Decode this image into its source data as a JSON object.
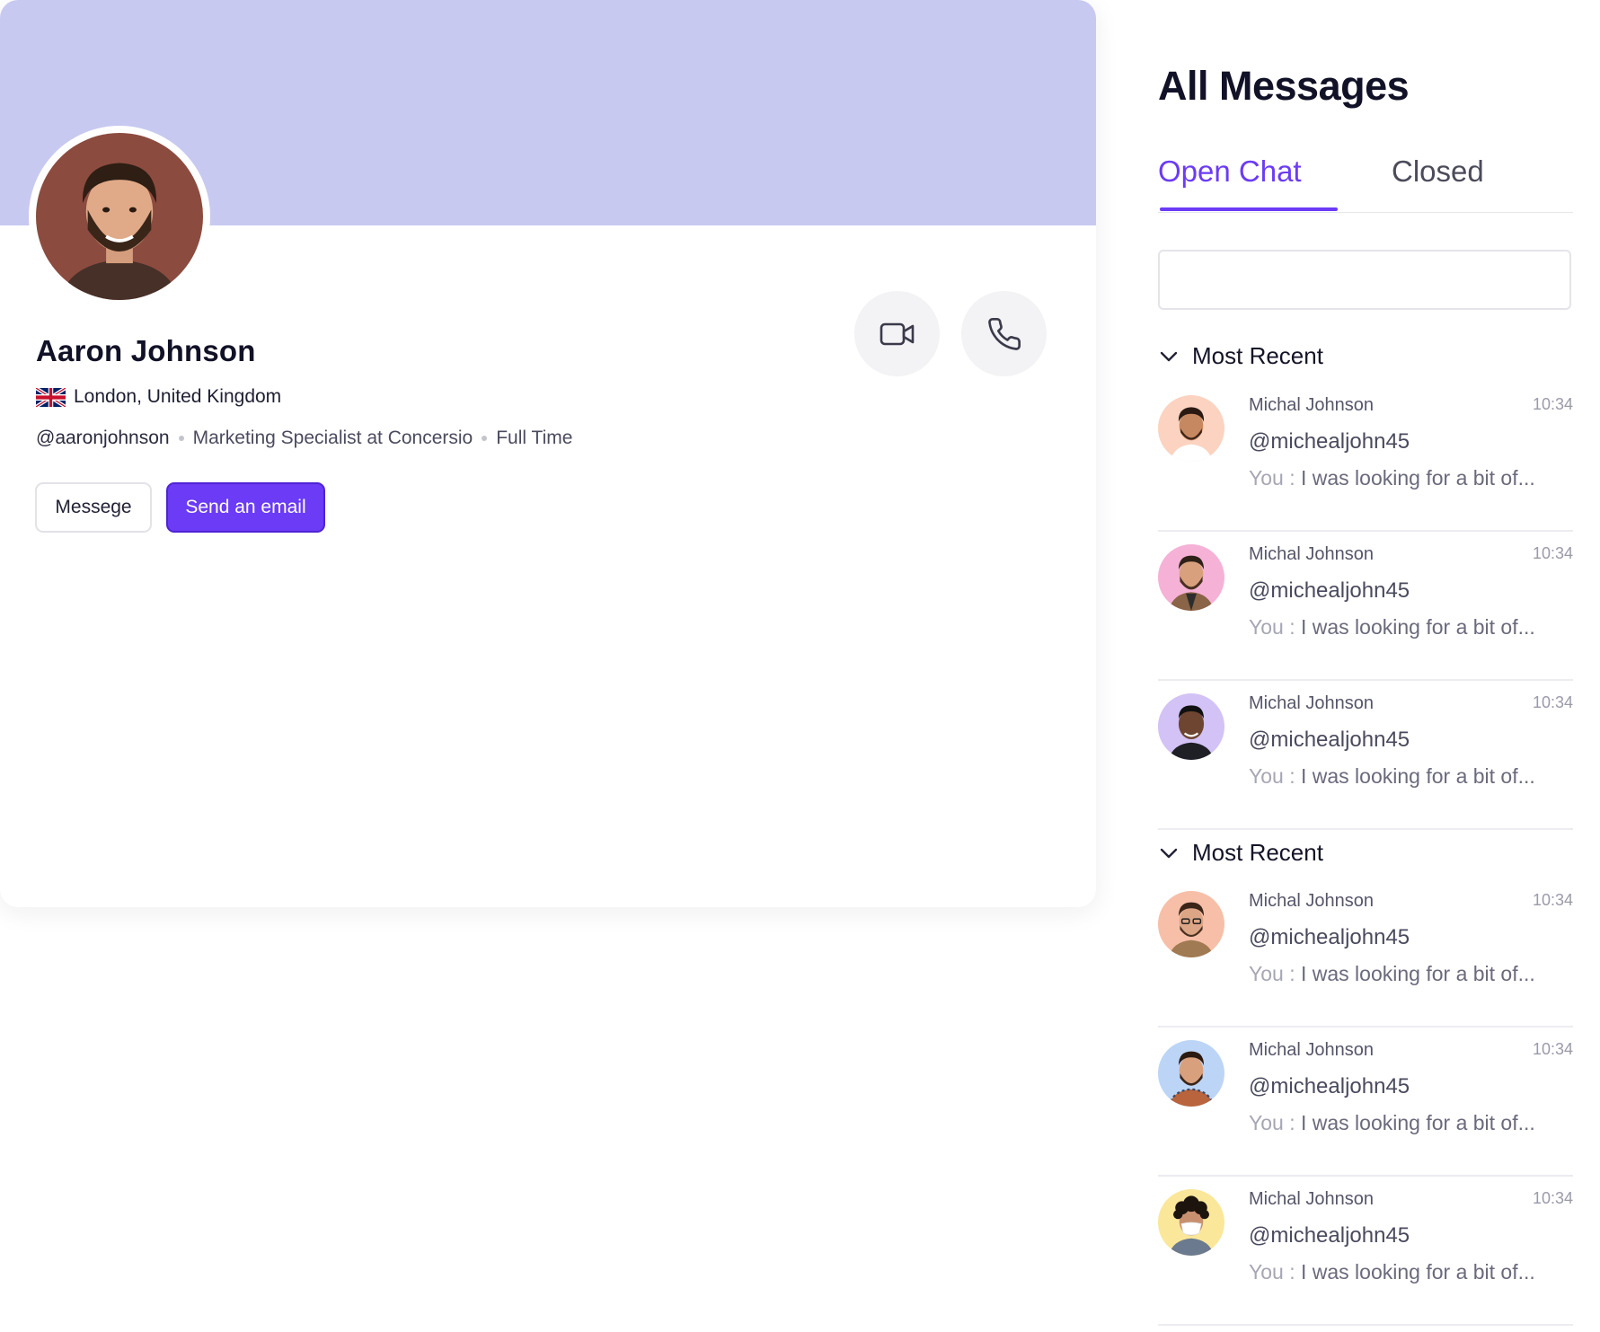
{
  "colors": {
    "accent": "#6b3bf5",
    "banner": "#c8c9f0",
    "divider": "#ececf1"
  },
  "profile": {
    "name": "Aaron Johnson",
    "location": "London, United Kingdom",
    "flag_icon": "uk-flag-icon",
    "handle": "@aaronjohnson",
    "role": "Marketing Specialist at Concersio",
    "employment": "Full Time",
    "message_button": "Messege",
    "email_button": "Send an email",
    "video_icon": "video-camera-icon",
    "phone_icon": "phone-icon"
  },
  "messages": {
    "title": "All Messages",
    "tabs": [
      {
        "label": "Open Chat",
        "active": true
      },
      {
        "label": "Closed",
        "active": false
      }
    ],
    "search": {
      "value": "",
      "placeholder": ""
    },
    "groups": [
      {
        "label": "Most Recent",
        "items": [
          {
            "name": "Michal Johnson",
            "time": "10:34",
            "handle": "@michealjohn45",
            "prefix": "You :",
            "text": "I was looking for a bit of...",
            "avatar_bg": "#fbd3c0"
          },
          {
            "name": "Michal Johnson",
            "time": "10:34",
            "handle": "@michealjohn45",
            "prefix": "You :",
            "text": "I was looking for a bit of...",
            "avatar_bg": "#f5b2d6"
          },
          {
            "name": "Michal Johnson",
            "time": "10:34",
            "handle": "@michealjohn45",
            "prefix": "You :",
            "text": "I was looking for a bit of...",
            "avatar_bg": "#d2c2f5"
          }
        ]
      },
      {
        "label": "Most Recent",
        "items": [
          {
            "name": "Michal Johnson",
            "time": "10:34",
            "handle": "@michealjohn45",
            "prefix": "You :",
            "text": "I was looking for a bit of...",
            "avatar_bg": "#f7bfa8"
          },
          {
            "name": "Michal Johnson",
            "time": "10:34",
            "handle": "@michealjohn45",
            "prefix": "You :",
            "text": "I was looking for a bit of...",
            "avatar_bg": "#bcd5f6"
          },
          {
            "name": "Michal Johnson",
            "time": "10:34",
            "handle": "@michealjohn45",
            "prefix": "You :",
            "text": "I was looking for a bit of...",
            "avatar_bg": "#fae79a"
          }
        ]
      }
    ]
  }
}
